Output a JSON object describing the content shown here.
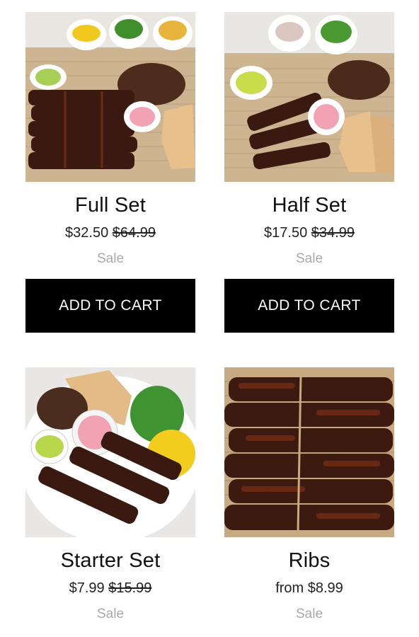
{
  "products": [
    {
      "title": "Full Set",
      "price": "$32.50",
      "compare_price": "$64.99",
      "badge": "Sale",
      "button": "ADD TO CART"
    },
    {
      "title": "Half Set",
      "price": "$17.50",
      "compare_price": "$34.99",
      "badge": "Sale",
      "button": "ADD TO CART"
    },
    {
      "title": "Starter Set",
      "price": "$7.99",
      "compare_price": "$15.99",
      "badge": "Sale"
    },
    {
      "title": "Ribs",
      "price": "from $8.99",
      "badge": "Sale"
    }
  ],
  "colors": {
    "button_bg": "#000000",
    "button_text": "#ffffff",
    "sale_text": "#a9a9a9"
  }
}
